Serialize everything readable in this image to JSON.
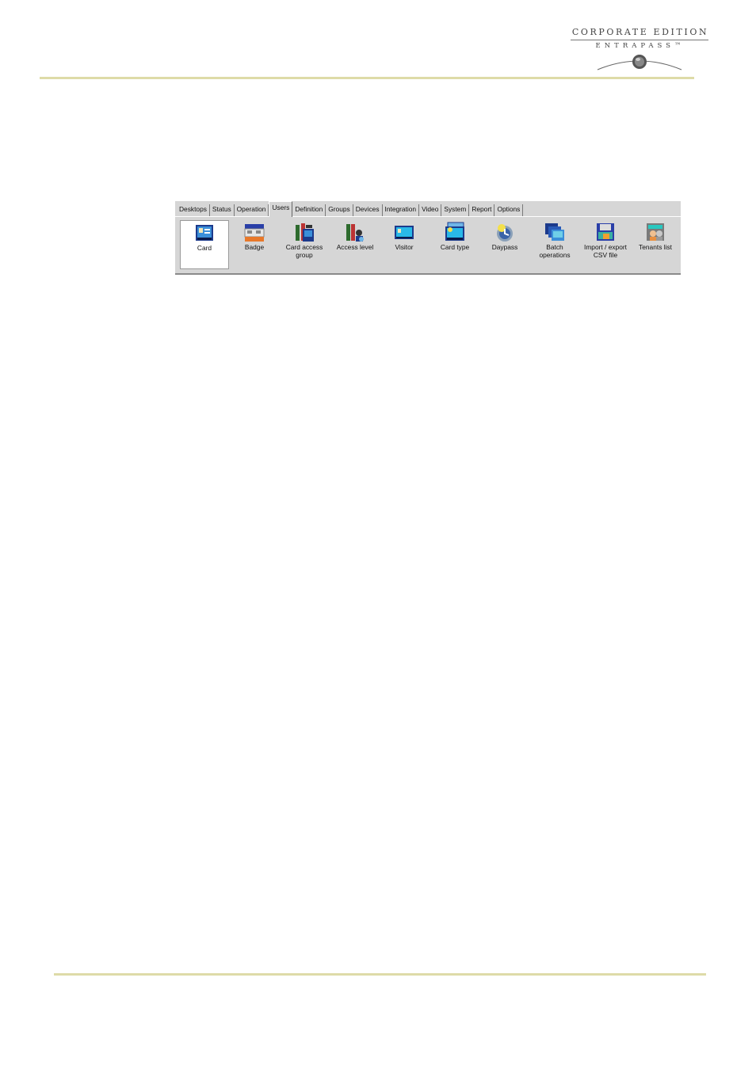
{
  "header": {
    "logo_line1": "CORPORATE EDITION",
    "logo_line2": "ENTRAPASS™"
  },
  "toolbar": {
    "tabs": [
      "Desktops",
      "Status",
      "Operation",
      "Users",
      "Definition",
      "Groups",
      "Devices",
      "Integration",
      "Video",
      "System",
      "Report",
      "Options"
    ],
    "active_tab": "Users",
    "items": [
      {
        "label": "Card",
        "icon": "card-icon"
      },
      {
        "label": "Badge",
        "icon": "badge-icon"
      },
      {
        "label": "Card access\ngroup",
        "icon": "card-access-group-icon"
      },
      {
        "label": "Access level",
        "icon": "access-level-icon"
      },
      {
        "label": "Visitor",
        "icon": "visitor-icon"
      },
      {
        "label": "Card type",
        "icon": "card-type-icon"
      },
      {
        "label": "Daypass",
        "icon": "daypass-icon"
      },
      {
        "label": "Batch\noperations",
        "icon": "batch-operations-icon"
      },
      {
        "label": "Import / export\nCSV file",
        "icon": "import-export-csv-icon"
      },
      {
        "label": "Tenants list",
        "icon": "tenants-list-icon"
      }
    ],
    "selected_item": "Card"
  }
}
